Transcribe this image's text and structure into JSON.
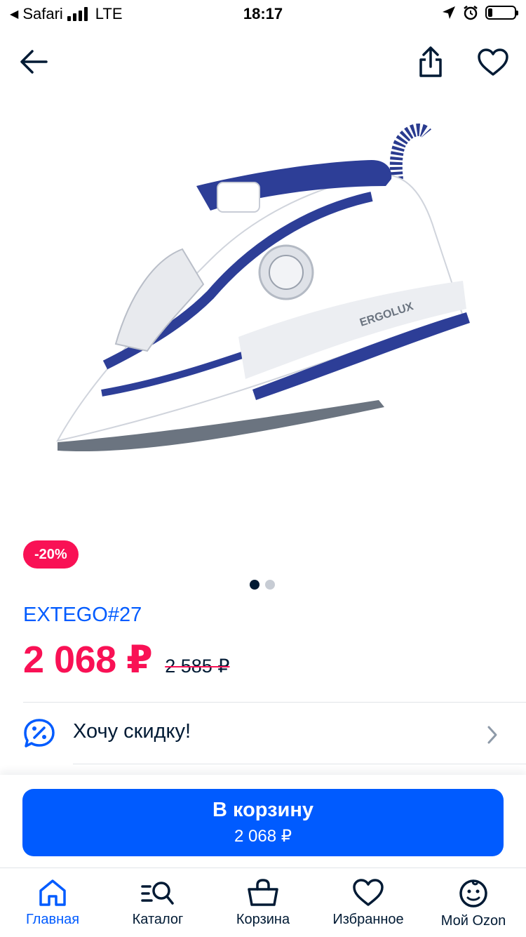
{
  "status_bar": {
    "back_app": "Safari",
    "network": "LTE",
    "time": "18:17"
  },
  "header": {
    "back_icon": "arrow-left-icon",
    "share_icon": "share-icon",
    "favorite_icon": "heart-icon"
  },
  "product": {
    "discount_badge": "-20%",
    "gallery_index": 1,
    "gallery_count": 2,
    "image_lettering": "ERGOLUX",
    "seller": "EXTEGO#27",
    "price": "2 068 ₽",
    "old_price": "2 585 ₽"
  },
  "discount_row": {
    "icon": "discount-chat-icon",
    "label": "Хочу скидку!",
    "chevron_icon": "chevron-right-icon"
  },
  "cart_button": {
    "title": "В корзину",
    "price": "2 068 ₽"
  },
  "tabbar": {
    "items": [
      {
        "label": "Главная",
        "icon": "home-icon",
        "active": true
      },
      {
        "label": "Каталог",
        "icon": "catalog-search-icon",
        "active": false
      },
      {
        "label": "Корзина",
        "icon": "basket-icon",
        "active": false
      },
      {
        "label": "Избранное",
        "icon": "heart-icon",
        "active": false
      },
      {
        "label": "Мой Ozon",
        "icon": "profile-smile-icon",
        "active": false
      }
    ]
  },
  "colors": {
    "brand_blue": "#005bff",
    "sale_pink": "#f91155",
    "text_dark": "#001a34"
  }
}
